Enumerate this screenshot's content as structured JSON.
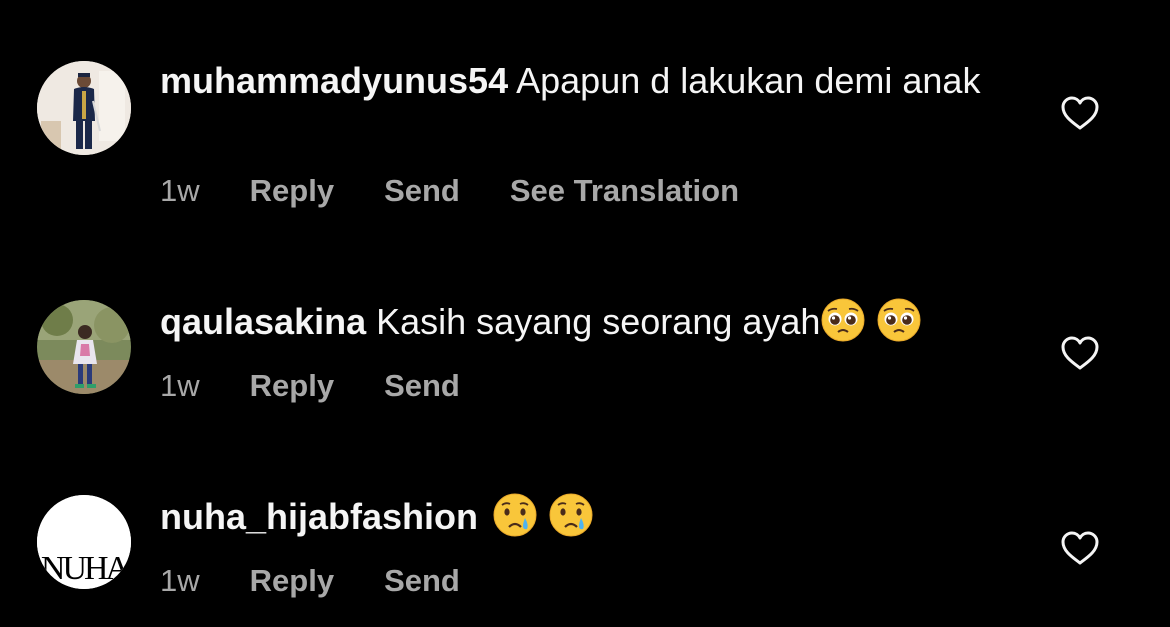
{
  "comments": [
    {
      "username": "muhammadyunus54",
      "text": "Apapun d lakukan demi anak",
      "time": "1w",
      "reply": "Reply",
      "send": "Send",
      "translate": "See Translation",
      "avatar": "uniformed-man-avatar"
    },
    {
      "username": "qaulasakina",
      "text": "Kasih sayang seorang ayah",
      "emojis": [
        "pleading-face-emoji",
        "pleading-face-emoji"
      ],
      "time": "1w",
      "reply": "Reply",
      "send": "Send",
      "avatar": "child-photo-avatar"
    },
    {
      "username": "nuha_hijabfashion",
      "text": "",
      "emojis": [
        "crying-face-emoji",
        "crying-face-emoji"
      ],
      "time": "1w",
      "reply": "Reply",
      "send": "Send",
      "avatar": "nuha-logo-avatar",
      "avatar_logo_text": "NUHA"
    }
  ],
  "icons": {
    "like": "heart-outline-icon"
  },
  "colors": {
    "background": "#000000",
    "text": "#f5f5f5",
    "meta": "#a8a8a8"
  }
}
